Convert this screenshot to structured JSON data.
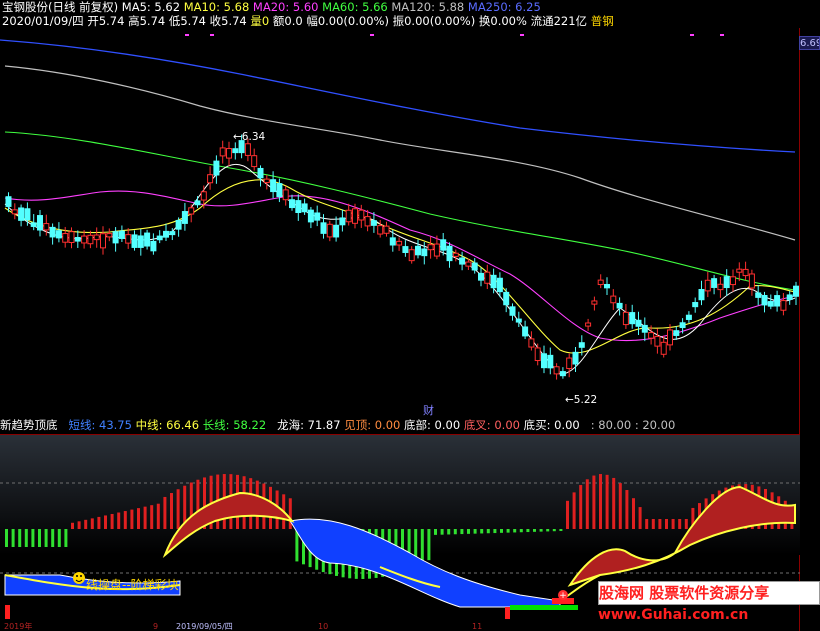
{
  "header": {
    "stock_name": "宝钢股份(日线 前复权)",
    "ma5": "MA5: 5.62",
    "ma10": "MA10: 5.68",
    "ma20": "MA20: 5.60",
    "ma60": "MA60: 5.66",
    "ma120": "MA120: 5.88",
    "ma250": "MA250: 6.25"
  },
  "ohlc": {
    "date": "2020/01/09/四",
    "open": "开5.74",
    "high": "高5.74",
    "low": "低5.74",
    "close": "收5.74",
    "volume": "量0",
    "amount": "额0.0",
    "range": "幅0.00(0.00%)",
    "amplitude": "振0.00(0.00%)",
    "turnover": "换0.00%",
    "float_cap": "流通221亿",
    "sector": "普钢"
  },
  "price_axis_label": "6.69",
  "annotations": {
    "high": "←6.34",
    "low": "←5.22",
    "cai": "财"
  },
  "indicator": {
    "name": "新趋势顶底",
    "short_line": "短线: 43.75",
    "mid_line": "中线: 66.46",
    "long_line": "长线: 58.22",
    "longhai": "龙海: 71.87",
    "jianding": "见顶: 0.00",
    "dibu": "底部: 0.00",
    "dicha": "底叉: 0.00",
    "dimai": "底买: 0.00",
    "levels": ": 80.00 : 20.00",
    "panel_tag": "线操盘--阶梯彩块"
  },
  "watermark": {
    "title": "股海网 股票软件资源分享",
    "url": "www.Guhai.com.cn"
  },
  "bottom_axis": [
    "2019年",
    "9",
    "2019/09/05/四",
    "10",
    "11"
  ],
  "colors": {
    "up": "#ff3030",
    "down": "#54ffff",
    "ma5": "#ffffff",
    "ma10": "#ffff40",
    "ma20": "#ff40ff",
    "ma60": "#40ff40",
    "ma120": "#c0c0c0",
    "ma250": "#3050ff"
  }
}
